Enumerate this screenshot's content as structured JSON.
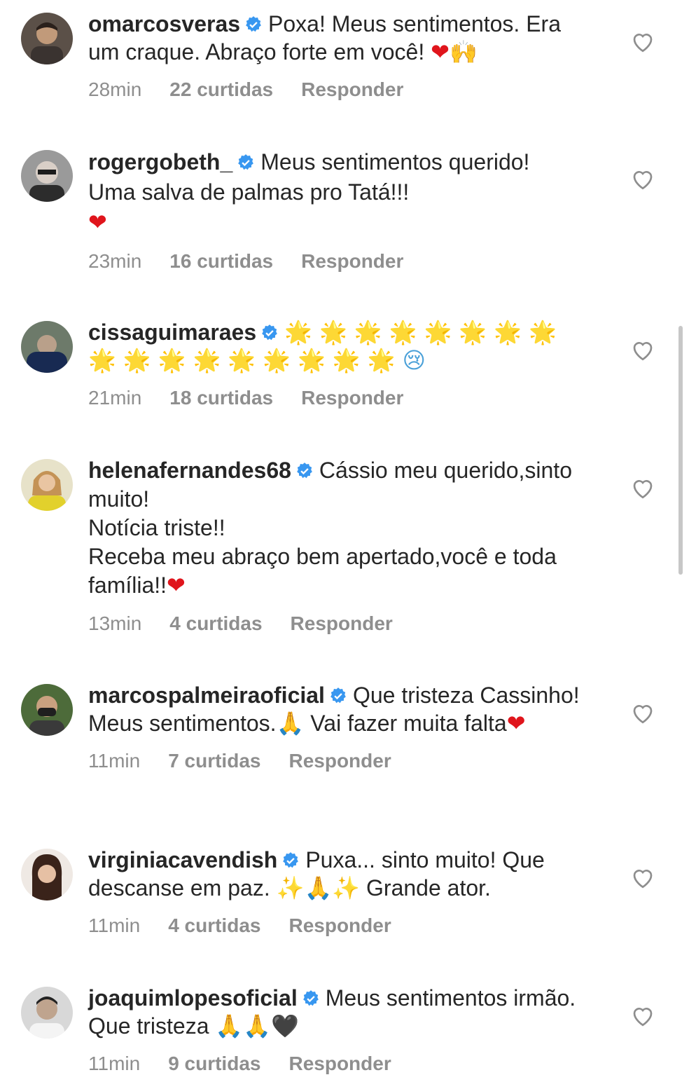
{
  "comments": [
    {
      "username": "omarcosveras",
      "text_parts": [
        "Poxa! Meus sentimentos. Era um craque. Abraço forte em você! ",
        "❤",
        "🙌"
      ],
      "time": "28min",
      "likes": "22 curtidas",
      "reply": "Responder"
    },
    {
      "username": "rogergobeth_",
      "text_parts": [
        "Meus sentimentos querido!\nUma salva de palmas pro Tatá!!!\n",
        "❤"
      ],
      "time": "23min",
      "likes": "16 curtidas",
      "reply": "Responder"
    },
    {
      "username": "cissaguimaraes",
      "text_parts": [
        "🌟🌟🌟🌟🌟🌟🌟🌟🌟🌟🌟🌟🌟🌟🌟🌟🌟",
        "😢"
      ],
      "time": "21min",
      "likes": "18 curtidas",
      "reply": "Responder"
    },
    {
      "username": "helenafernandes68",
      "text_parts": [
        "Cássio meu querido,sinto muito!\nNotícia triste!!\nReceba meu abraço bem apertado,você e toda família!!",
        "❤"
      ],
      "time": "13min",
      "likes": "4 curtidas",
      "reply": "Responder"
    },
    {
      "username": "marcospalmeiraoficial",
      "text_parts": [
        "Que tristeza Cassinho! Meus sentimentos.",
        "🙏",
        " Vai fazer muita falta",
        "❤"
      ],
      "time": "11min",
      "likes": "7 curtidas",
      "reply": "Responder"
    },
    {
      "username": "virginiacavendish",
      "text_parts": [
        "Puxa... sinto muito! Que descanse em paz. ",
        "✨🙏✨",
        " Grande ator."
      ],
      "time": "11min",
      "likes": "4 curtidas",
      "reply": "Responder"
    },
    {
      "username": "joaquimlopesoficial",
      "text_parts": [
        "Meus sentimentos irmão. Que tristeza ",
        "🙏🙏",
        "🖤"
      ],
      "time": "11min",
      "likes": "9 curtidas",
      "reply": "Responder"
    }
  ],
  "colors": {
    "text": "#262626",
    "meta": "#8e8e8e",
    "verified": "#3897f0",
    "heart_outline": "#8e8e8e"
  },
  "icons": {
    "verified": "verified-badge-icon",
    "like": "heart-outline-icon"
  }
}
